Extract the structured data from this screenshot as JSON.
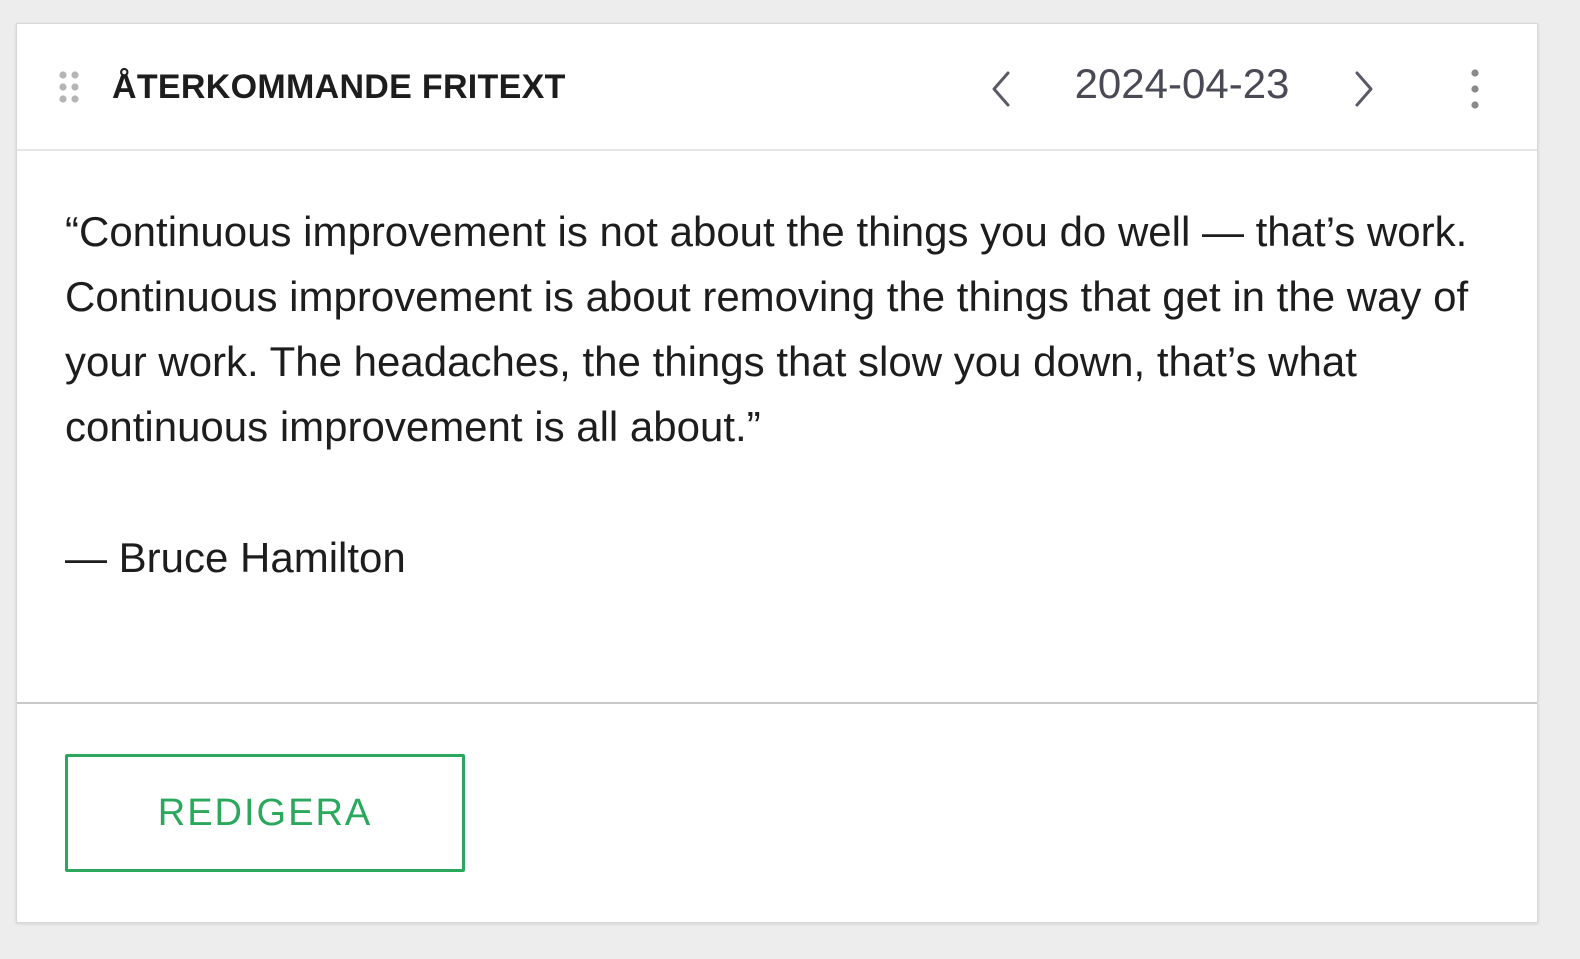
{
  "card": {
    "title": "ÅTERKOMMANDE FRITEXT",
    "date": "2024-04-23",
    "quote": "“Continuous improvement is not about the things you do well — that’s work. Continuous improvement is about removing the things that get in the way of your work. The headaches, the things that slow you down, that’s what continuous improvement is all about.”",
    "author": "— Bruce Hamilton",
    "edit_label": "REDIGERA"
  },
  "icons": {
    "drag": "drag-handle-icon",
    "prev": "chevron-left-icon",
    "next": "chevron-right-icon",
    "menu": "more-vertical-icon"
  },
  "colors": {
    "accent": "#2aa85c",
    "title": "#1d1d1d",
    "date": "#4a4a57",
    "icon": "#8a8a8a"
  }
}
